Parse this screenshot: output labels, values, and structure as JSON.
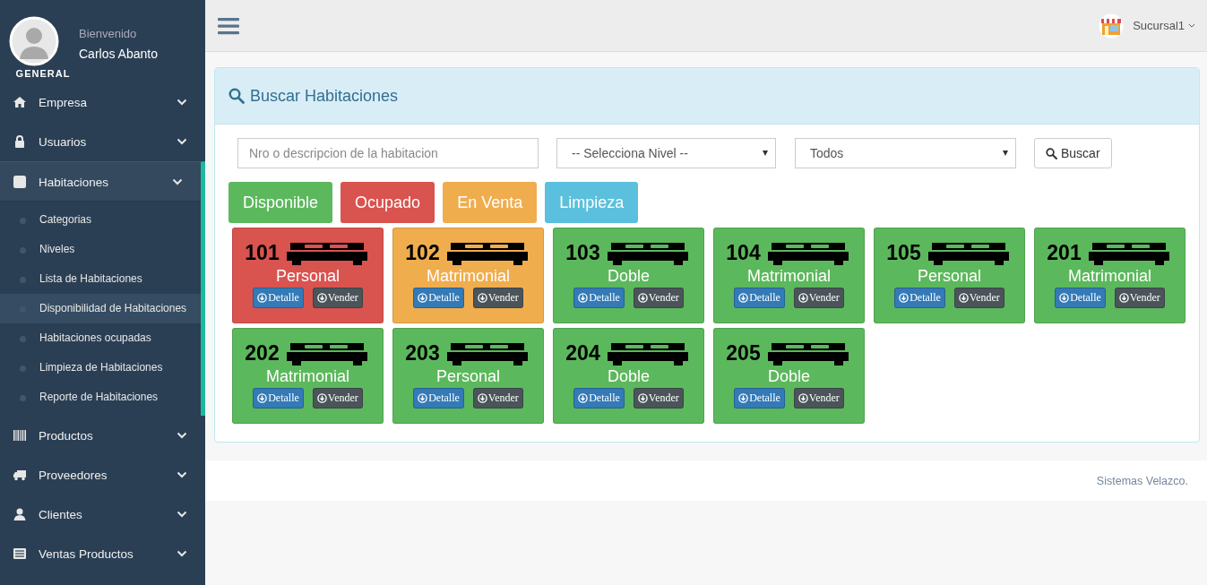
{
  "profile": {
    "greeting": "Bienvenido",
    "name": "Carlos Abanto",
    "role": "GENERAL"
  },
  "sidebar": {
    "items": [
      {
        "label": "Empresa",
        "expanded": false
      },
      {
        "label": "Usuarios",
        "expanded": false
      },
      {
        "label": "Habitaciones",
        "expanded": true,
        "children": [
          {
            "label": "Categorias",
            "selected": false
          },
          {
            "label": "Niveles",
            "selected": false
          },
          {
            "label": "Lista de Habitaciones",
            "selected": false
          },
          {
            "label": "Disponibilidad de Habitaciones",
            "selected": true
          },
          {
            "label": "Habitaciones ocupadas",
            "selected": false
          },
          {
            "label": "Limpieza de Habitaciones",
            "selected": false
          },
          {
            "label": "Reporte de Habitaciones",
            "selected": false
          }
        ]
      },
      {
        "label": "Productos",
        "expanded": false
      },
      {
        "label": "Proveedores",
        "expanded": false
      },
      {
        "label": "Clientes",
        "expanded": false
      },
      {
        "label": "Ventas Productos",
        "expanded": false
      }
    ]
  },
  "topbar": {
    "branch": "Sucursal1"
  },
  "panel": {
    "title": "Buscar Habitaciones",
    "search": {
      "placeholder": "Nro o descripcion de la habitacion"
    },
    "level_select": "-- Selecciona Nivel --",
    "status_select": "Todos",
    "search_button": "Buscar",
    "legend": [
      {
        "label": "Disponible",
        "color": "#5cb85c"
      },
      {
        "label": "Ocupado",
        "color": "#d9534f"
      },
      {
        "label": "En Venta",
        "color": "#f0ad4e"
      },
      {
        "label": "Limpieza",
        "color": "#5bc0de"
      }
    ],
    "rooms": [
      {
        "number": "101",
        "type": "Personal",
        "color": "#d9534f",
        "detail": "Detalle",
        "sell": "Vender"
      },
      {
        "number": "102",
        "type": "Matrimonial",
        "color": "#f0ad4e",
        "detail": "Detalle",
        "sell": "Vender"
      },
      {
        "number": "103",
        "type": "Doble",
        "color": "#5cb85c",
        "detail": "Detalle",
        "sell": "Vender"
      },
      {
        "number": "104",
        "type": "Matrimonial",
        "color": "#5cb85c",
        "detail": "Detalle",
        "sell": "Vender"
      },
      {
        "number": "105",
        "type": "Personal",
        "color": "#5cb85c",
        "detail": "Detalle",
        "sell": "Vender"
      },
      {
        "number": "201",
        "type": "Matrimonial",
        "color": "#5cb85c",
        "detail": "Detalle",
        "sell": "Vender"
      },
      {
        "number": "202",
        "type": "Matrimonial",
        "color": "#5cb85c",
        "detail": "Detalle",
        "sell": "Vender"
      },
      {
        "number": "203",
        "type": "Personal",
        "color": "#5cb85c",
        "detail": "Detalle",
        "sell": "Vender"
      },
      {
        "number": "204",
        "type": "Doble",
        "color": "#5cb85c",
        "detail": "Detalle",
        "sell": "Vender"
      },
      {
        "number": "205",
        "type": "Doble",
        "color": "#5cb85c",
        "detail": "Detalle",
        "sell": "Vender"
      }
    ]
  },
  "footer": "Sistemas Velazco."
}
